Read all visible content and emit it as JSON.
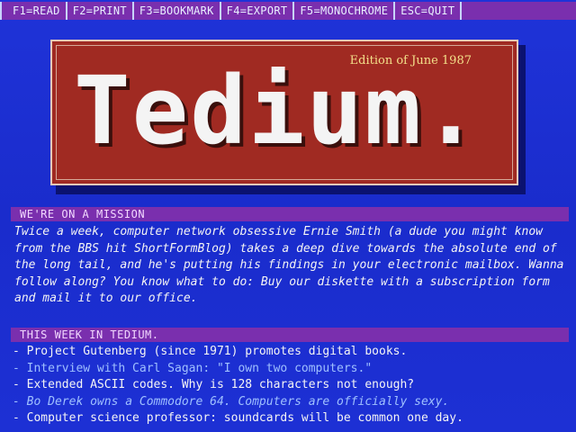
{
  "menu": {
    "items": [
      {
        "label": "F1=READ"
      },
      {
        "label": "F2=PRINT"
      },
      {
        "label": "F3=BOOKMARK"
      },
      {
        "label": "F4=EXPORT"
      },
      {
        "label": "F5=MONOCHROME"
      },
      {
        "label": "ESC=QUIT"
      }
    ]
  },
  "masthead": {
    "edition": "Edition of June 1987",
    "title": "Tedium."
  },
  "mission": {
    "header": "WE'RE ON A MISSION",
    "text": "Twice a week, computer network obsessive Ernie Smith (a dude you might know from the BBS hit ShortFormBlog) takes a deep dive towards the absolute end of the long tail, and he's putting his findings in your electronic mailbox. Wanna follow along? You know what to do: Buy our diskette with a subscription form and mail it to our office."
  },
  "this_week": {
    "header": "THIS WEEK IN TEDIUM.",
    "items": [
      "- Project Gutenberg (since 1971) promotes digital books.",
      "- Interview with Carl Sagan: \"I own two computers.\"",
      "- Extended ASCII codes. Why is 128 characters not enough?",
      "- Bo Derek owns a Commodore 64. Computers are officially sexy.",
      "- Computer science professor: soundcards will be common one day."
    ]
  },
  "colors": {
    "background": "#1a2bd0",
    "menubar": "#7a2fae",
    "masthead": "#a02a22",
    "edition_text": "#f3e08a",
    "highlight_text": "#9fc0ff"
  }
}
